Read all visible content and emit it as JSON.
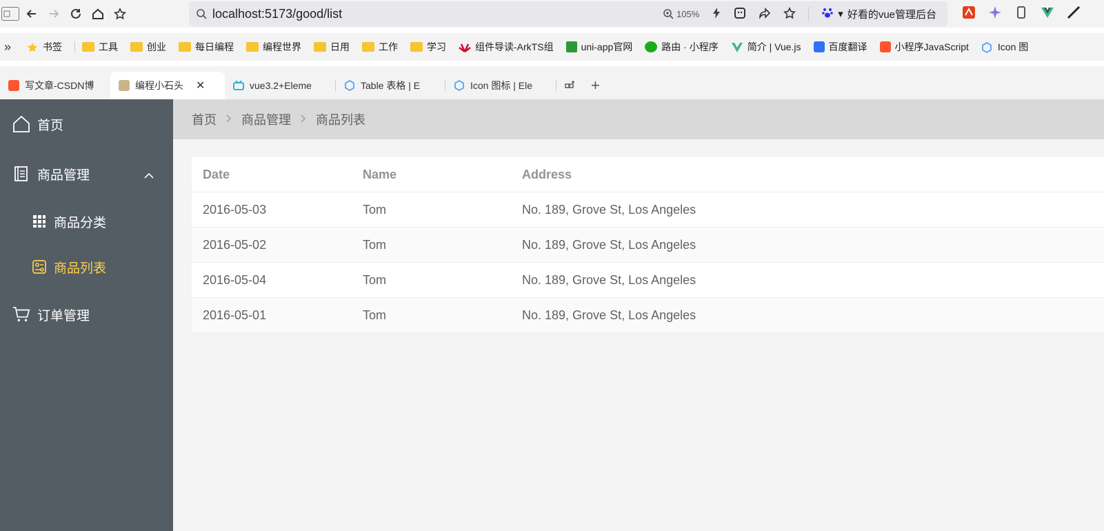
{
  "browser": {
    "url": "localhost:5173/good/list",
    "zoom": "105%",
    "site_name": "好看的vue管理后台"
  },
  "bookmarks": [
    {
      "label": "书签",
      "icon": "star-icon"
    },
    {
      "label": "工具",
      "icon": "folder-icon"
    },
    {
      "label": "创业",
      "icon": "folder-icon"
    },
    {
      "label": "每日编程",
      "icon": "folder-icon"
    },
    {
      "label": "编程世界",
      "icon": "folder-icon"
    },
    {
      "label": "日用",
      "icon": "folder-icon"
    },
    {
      "label": "工作",
      "icon": "folder-icon"
    },
    {
      "label": "学习",
      "icon": "folder-icon"
    },
    {
      "label": "组件导读-ArkTS组",
      "icon": "huawei-icon"
    },
    {
      "label": "uni-app官网",
      "icon": "uniapp-icon"
    },
    {
      "label": "路由 · 小程序",
      "icon": "wechat-icon"
    },
    {
      "label": "简介 | Vue.js",
      "icon": "vue-icon"
    },
    {
      "label": "百度翻译",
      "icon": "translate-icon"
    },
    {
      "label": "小程序JavaScript",
      "icon": "csdn-icon"
    },
    {
      "label": "Icon 图",
      "icon": "element-icon"
    }
  ],
  "tabs": [
    {
      "label": "写文章-CSDN博",
      "active": false,
      "icon": "csdn-icon"
    },
    {
      "label": "编程小石头",
      "active": true,
      "icon": "avatar-icon"
    },
    {
      "label": "vue3.2+Eleme",
      "active": false,
      "icon": "bilibili-icon"
    },
    {
      "label": "Table 表格 | E",
      "active": false,
      "icon": "element-icon"
    },
    {
      "label": "Icon 图标 | Ele",
      "active": false,
      "icon": "element-icon"
    }
  ],
  "sidebar": {
    "home": "首页",
    "goods": "商品管理",
    "goods_category": "商品分类",
    "goods_list": "商品列表",
    "orders": "订单管理",
    "active_color": "#ffd04b",
    "bg_color": "#545c64"
  },
  "breadcrumb": [
    "首页",
    "商品管理",
    "商品列表"
  ],
  "table": {
    "headers": [
      "Date",
      "Name",
      "Address"
    ],
    "rows": [
      [
        "2016-05-03",
        "Tom",
        "No. 189, Grove St, Los Angeles"
      ],
      [
        "2016-05-02",
        "Tom",
        "No. 189, Grove St, Los Angeles"
      ],
      [
        "2016-05-04",
        "Tom",
        "No. 189, Grove St, Los Angeles"
      ],
      [
        "2016-05-01",
        "Tom",
        "No. 189, Grove St, Los Angeles"
      ]
    ]
  }
}
